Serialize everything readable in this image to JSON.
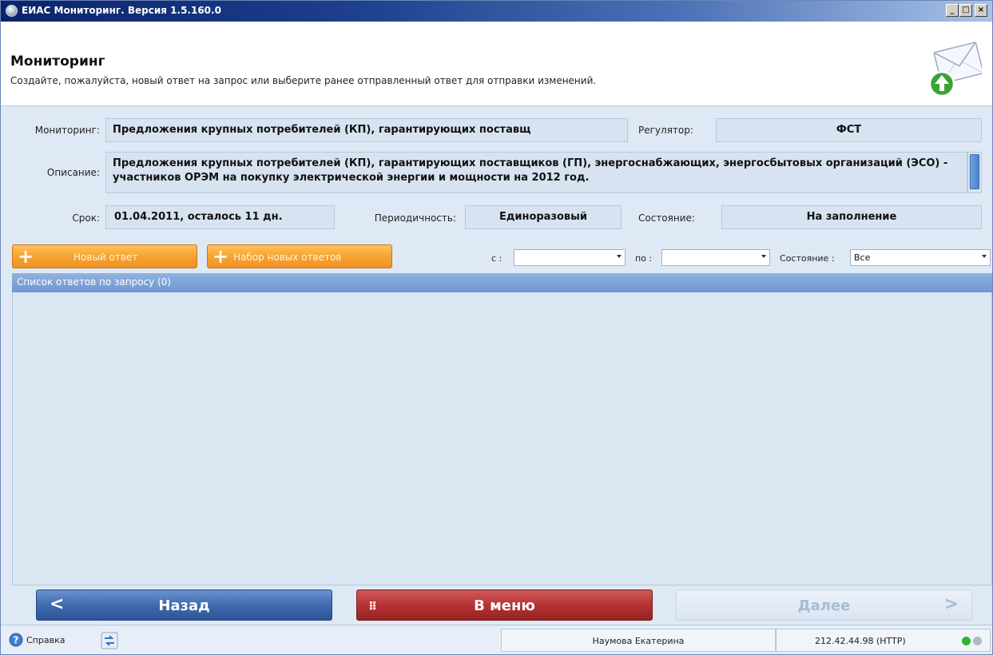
{
  "window": {
    "title": "ЕИАС Мониторинг. Версия 1.5.160.0",
    "controls": [
      "_",
      "□",
      "×"
    ]
  },
  "header": {
    "title": "Мониторинг",
    "subtitle": "Создайте, пожалуйста, новый ответ на запрос или выберите ранее отправленный ответ для отправки изменений.",
    "icon": "mail-upload-icon"
  },
  "form": {
    "monitoring_label": "Мониторинг:",
    "monitoring_value": "Предложения крупных потребителей (КП), гарантирующих поставщ",
    "regulator_label": "Регулятор:",
    "regulator_value": "ФСТ",
    "description_label": "Описание:",
    "description_value": "Предложения крупных потребителей (КП), гарантирующих поставщиков (ГП), энергоснабжающих, энергосбытовых организаций (ЭСО) - участников ОРЭМ на покупку электрической энергии и мощности на 2012 год.",
    "deadline_label": "Срок:",
    "deadline_value": "01.04.2011, осталось 11 дн.",
    "periodicity_label": "Периодичность:",
    "periodicity_value": "Единоразовый",
    "state_label": "Состояние:",
    "state_value": "На заполнение"
  },
  "toolbar": {
    "new_answer_label": "Новый ответ",
    "new_answers_set_label": "Набор новых ответов",
    "from_label": "с :",
    "from_value": "",
    "to_label": "по :",
    "to_value": "",
    "state_filter_label": "Состояние :",
    "state_filter_value": "Все"
  },
  "list": {
    "header": "Список ответов по запросу (0)",
    "items": []
  },
  "nav": {
    "back_label": "Назад",
    "menu_label": "В меню",
    "next_label": "Далее"
  },
  "statusbar": {
    "help_label": "Справка",
    "user": "Наумова Екатерина",
    "server": "212.42.44.98 (HTTP)"
  },
  "colors": {
    "accent_blue": "#3c68ac",
    "accent_red": "#b33030",
    "accent_orange": "#f6a332",
    "status_green": "#2bb52b",
    "status_gray": "#b0b8c4"
  }
}
